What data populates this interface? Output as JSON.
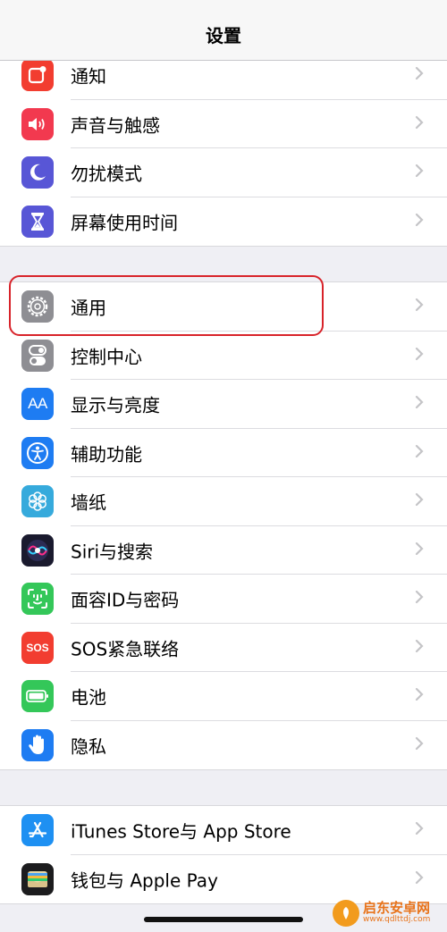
{
  "header": {
    "title": "设置"
  },
  "groups": [
    {
      "items": [
        {
          "label": "通知",
          "icon": "notifications-icon",
          "color": "#f23d30"
        },
        {
          "label": "声音与触感",
          "icon": "sound-icon",
          "color": "#f2394f"
        },
        {
          "label": "勿扰模式",
          "icon": "moon-icon",
          "color": "#5856d6"
        },
        {
          "label": "屏幕使用时间",
          "icon": "hourglass-icon",
          "color": "#5856d6"
        }
      ]
    },
    {
      "items": [
        {
          "label": "通用",
          "icon": "gear-icon",
          "color": "#8e8e93"
        },
        {
          "label": "控制中心",
          "icon": "toggles-icon",
          "color": "#8e8e93"
        },
        {
          "label": "显示与亮度",
          "icon": "text-size-icon",
          "text": "AA",
          "color": "#1e7cf2"
        },
        {
          "label": "辅助功能",
          "icon": "accessibility-icon",
          "color": "#1e7cf2"
        },
        {
          "label": "墙纸",
          "icon": "wallpaper-flower-icon",
          "color": "#36aadc"
        },
        {
          "label": "Siri与搜索",
          "icon": "siri-icon",
          "color": "#1a1a2e"
        },
        {
          "label": "面容ID与密码",
          "icon": "face-id-icon",
          "color": "#34c759"
        },
        {
          "label": "SOS紧急联络",
          "icon": "sos-icon",
          "text": "SOS",
          "color": "#f23d30"
        },
        {
          "label": "电池",
          "icon": "battery-icon",
          "color": "#34c759"
        },
        {
          "label": "隐私",
          "icon": "hand-icon",
          "color": "#1e7cf2"
        }
      ]
    },
    {
      "items": [
        {
          "label": "iTunes Store与 App Store",
          "icon": "app-store-icon",
          "color": "#1e90f2"
        },
        {
          "label": "钱包与 Apple Pay",
          "icon": "wallet-icon",
          "color": "#1c1c1e"
        }
      ]
    }
  ],
  "watermark": {
    "main": "启东安卓网",
    "sub": "www.qdlttdj.com"
  }
}
